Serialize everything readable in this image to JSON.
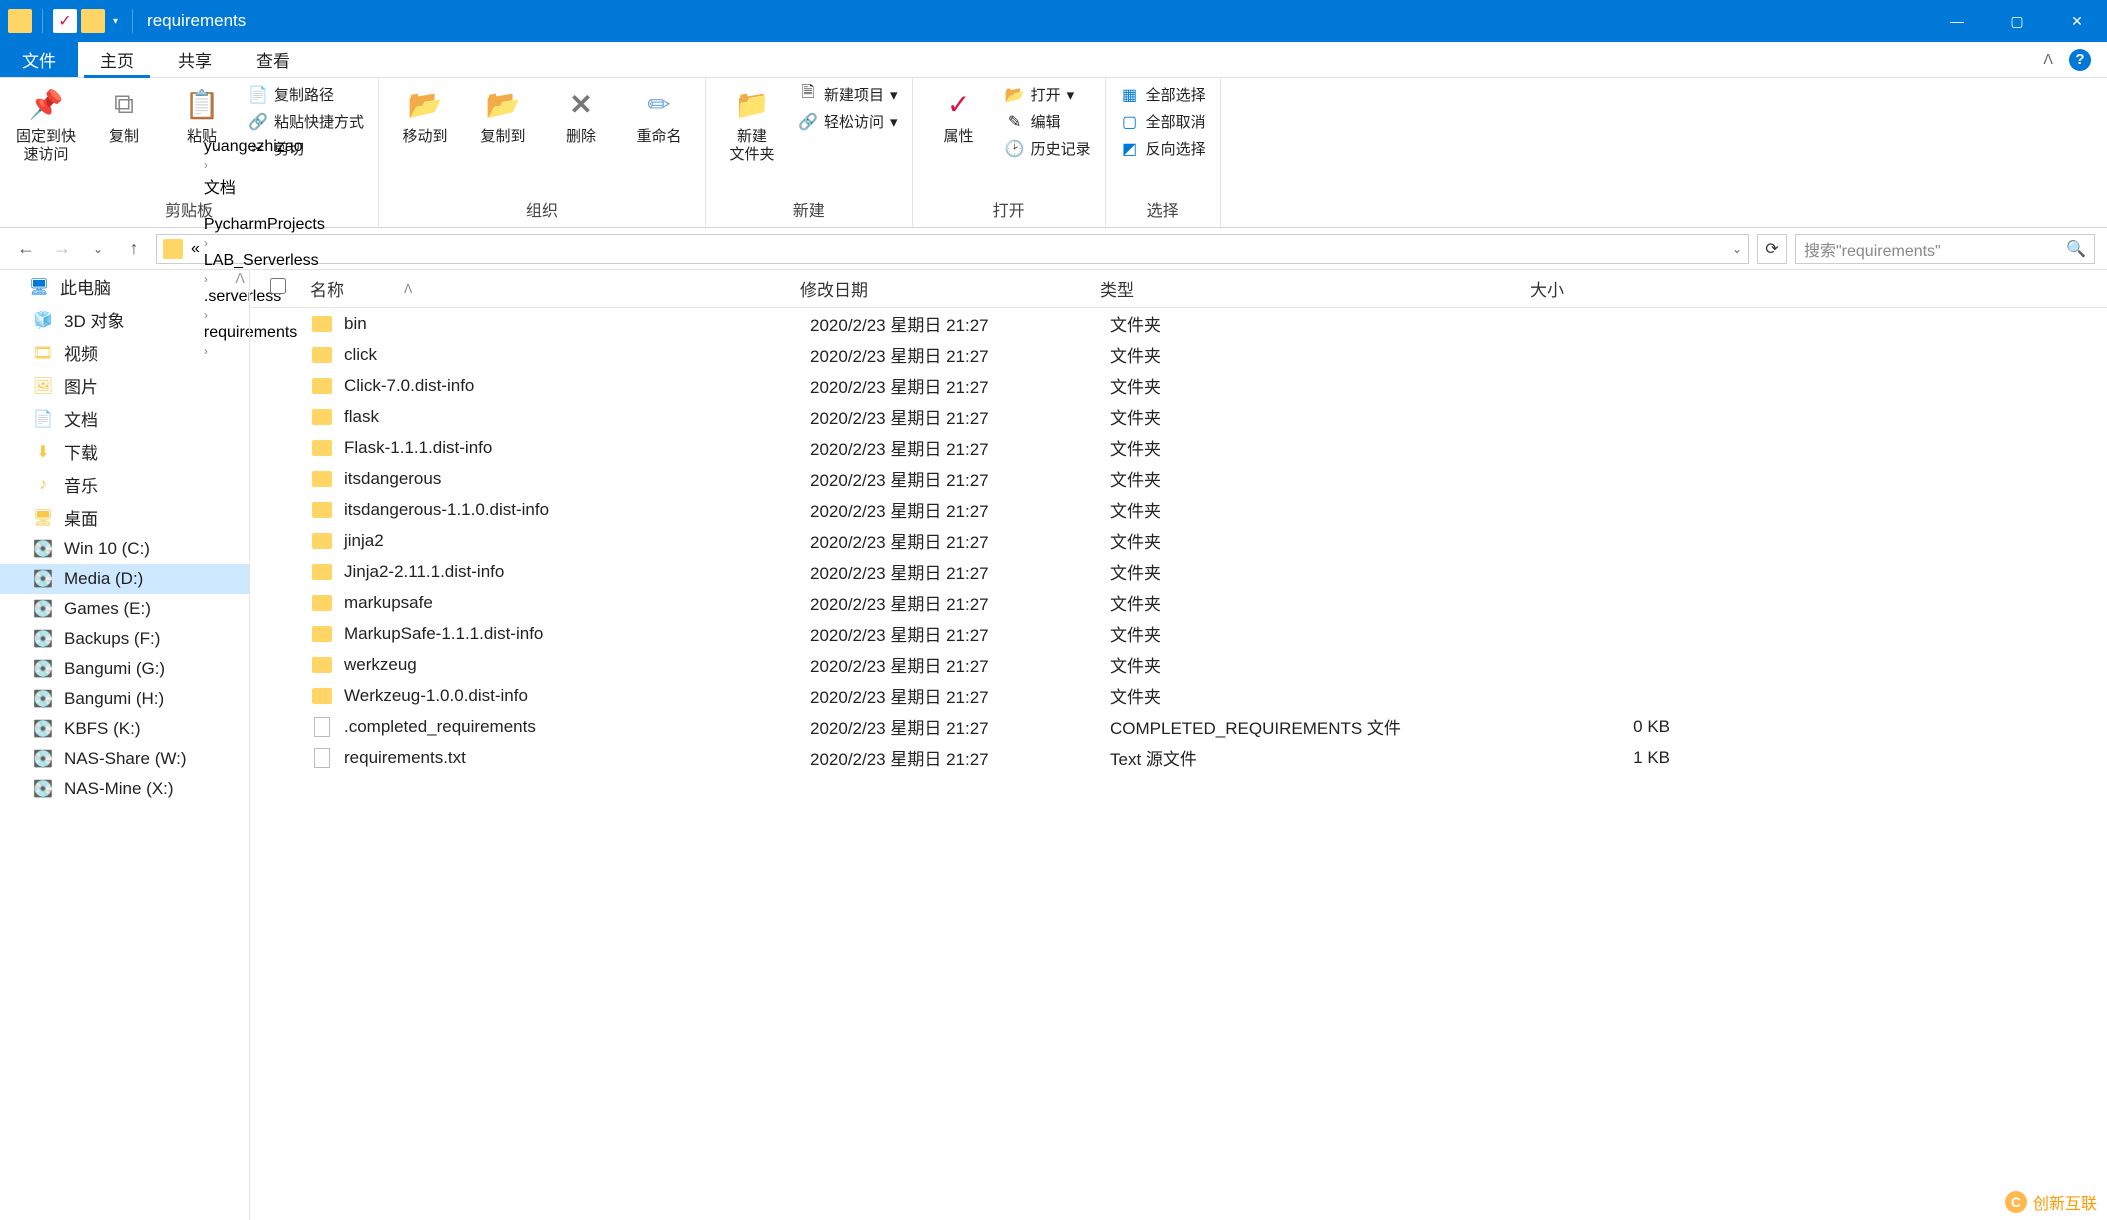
{
  "window": {
    "title": "requirements"
  },
  "tabs": {
    "file": "文件",
    "home": "主页",
    "share": "共享",
    "view": "查看"
  },
  "ribbon": {
    "group_clipboard": "剪贴板",
    "group_organize": "组织",
    "group_new": "新建",
    "group_open": "打开",
    "group_select": "选择",
    "pin": "固定到快\n速访问",
    "copy": "复制",
    "paste": "粘贴",
    "copy_path": "复制路径",
    "paste_shortcut": "粘贴快捷方式",
    "cut": "剪切",
    "move_to": "移动到",
    "copy_to": "复制到",
    "delete": "删除",
    "rename": "重命名",
    "new_folder": "新建\n文件夹",
    "new_item": "新建项目",
    "easy_access": "轻松访问",
    "properties": "属性",
    "open": "打开",
    "edit": "编辑",
    "history": "历史记录",
    "select_all": "全部选择",
    "select_none": "全部取消",
    "invert": "反向选择"
  },
  "breadcrumb": [
    "yuangezhizao",
    "文档",
    "PycharmProjects",
    "LAB_Serverless",
    ".serverless",
    "requirements"
  ],
  "search": {
    "placeholder": "搜索\"requirements\""
  },
  "columns": {
    "name": "名称",
    "date": "修改日期",
    "type": "类型",
    "size": "大小"
  },
  "sidebar": [
    {
      "label": "此电脑",
      "icon": "monitor",
      "root": true
    },
    {
      "label": "3D 对象",
      "icon": "3d"
    },
    {
      "label": "视频",
      "icon": "video"
    },
    {
      "label": "图片",
      "icon": "pics"
    },
    {
      "label": "文档",
      "icon": "docs"
    },
    {
      "label": "下载",
      "icon": "download"
    },
    {
      "label": "音乐",
      "icon": "music"
    },
    {
      "label": "桌面",
      "icon": "desktop"
    },
    {
      "label": "Win 10 (C:)",
      "icon": "drive"
    },
    {
      "label": "Media (D:)",
      "icon": "drive",
      "selected": true
    },
    {
      "label": "Games (E:)",
      "icon": "drive"
    },
    {
      "label": "Backups (F:)",
      "icon": "drive"
    },
    {
      "label": "Bangumi (G:)",
      "icon": "drive"
    },
    {
      "label": "Bangumi (H:)",
      "icon": "drive"
    },
    {
      "label": "KBFS (K:)",
      "icon": "drive"
    },
    {
      "label": "NAS-Share (W:)",
      "icon": "net"
    },
    {
      "label": "NAS-Mine (X:)",
      "icon": "net"
    }
  ],
  "files": [
    {
      "name": "bin",
      "date": "2020/2/23 星期日 21:27",
      "type": "文件夹",
      "size": "",
      "kind": "folder"
    },
    {
      "name": "click",
      "date": "2020/2/23 星期日 21:27",
      "type": "文件夹",
      "size": "",
      "kind": "folder"
    },
    {
      "name": "Click-7.0.dist-info",
      "date": "2020/2/23 星期日 21:27",
      "type": "文件夹",
      "size": "",
      "kind": "folder"
    },
    {
      "name": "flask",
      "date": "2020/2/23 星期日 21:27",
      "type": "文件夹",
      "size": "",
      "kind": "folder"
    },
    {
      "name": "Flask-1.1.1.dist-info",
      "date": "2020/2/23 星期日 21:27",
      "type": "文件夹",
      "size": "",
      "kind": "folder"
    },
    {
      "name": "itsdangerous",
      "date": "2020/2/23 星期日 21:27",
      "type": "文件夹",
      "size": "",
      "kind": "folder"
    },
    {
      "name": "itsdangerous-1.1.0.dist-info",
      "date": "2020/2/23 星期日 21:27",
      "type": "文件夹",
      "size": "",
      "kind": "folder"
    },
    {
      "name": "jinja2",
      "date": "2020/2/23 星期日 21:27",
      "type": "文件夹",
      "size": "",
      "kind": "folder"
    },
    {
      "name": "Jinja2-2.11.1.dist-info",
      "date": "2020/2/23 星期日 21:27",
      "type": "文件夹",
      "size": "",
      "kind": "folder"
    },
    {
      "name": "markupsafe",
      "date": "2020/2/23 星期日 21:27",
      "type": "文件夹",
      "size": "",
      "kind": "folder"
    },
    {
      "name": "MarkupSafe-1.1.1.dist-info",
      "date": "2020/2/23 星期日 21:27",
      "type": "文件夹",
      "size": "",
      "kind": "folder"
    },
    {
      "name": "werkzeug",
      "date": "2020/2/23 星期日 21:27",
      "type": "文件夹",
      "size": "",
      "kind": "folder"
    },
    {
      "name": "Werkzeug-1.0.0.dist-info",
      "date": "2020/2/23 星期日 21:27",
      "type": "文件夹",
      "size": "",
      "kind": "folder"
    },
    {
      "name": ".completed_requirements",
      "date": "2020/2/23 星期日 21:27",
      "type": "COMPLETED_REQUIREMENTS 文件",
      "size": "0 KB",
      "kind": "file"
    },
    {
      "name": "requirements.txt",
      "date": "2020/2/23 星期日 21:27",
      "type": "Text 源文件",
      "size": "1 KB",
      "kind": "file"
    }
  ],
  "watermark": "创新互联"
}
